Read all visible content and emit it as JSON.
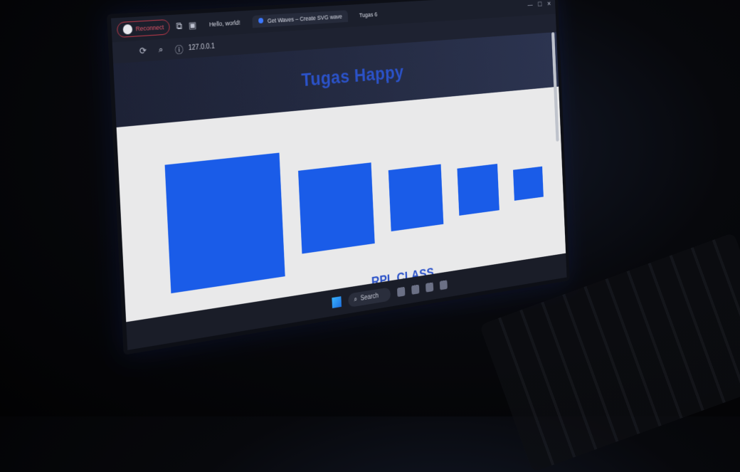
{
  "browser": {
    "profile_label": "Reconnect",
    "tabs": [
      {
        "label": "Hello, world!"
      },
      {
        "label": "Get Waves – Create SVG wave"
      },
      {
        "label": "Tugas 6"
      }
    ],
    "url": "127.0.0.1"
  },
  "page": {
    "title": "Tugas Happy",
    "subtitle": "RPL CLASS",
    "box_count": 5
  },
  "taskbar": {
    "search_label": "Search"
  },
  "colors": {
    "box_blue": "#1a5ce8",
    "title_blue": "#2b52c8",
    "page_bg": "#e9e9ea",
    "profile_accent": "#e3576a"
  }
}
